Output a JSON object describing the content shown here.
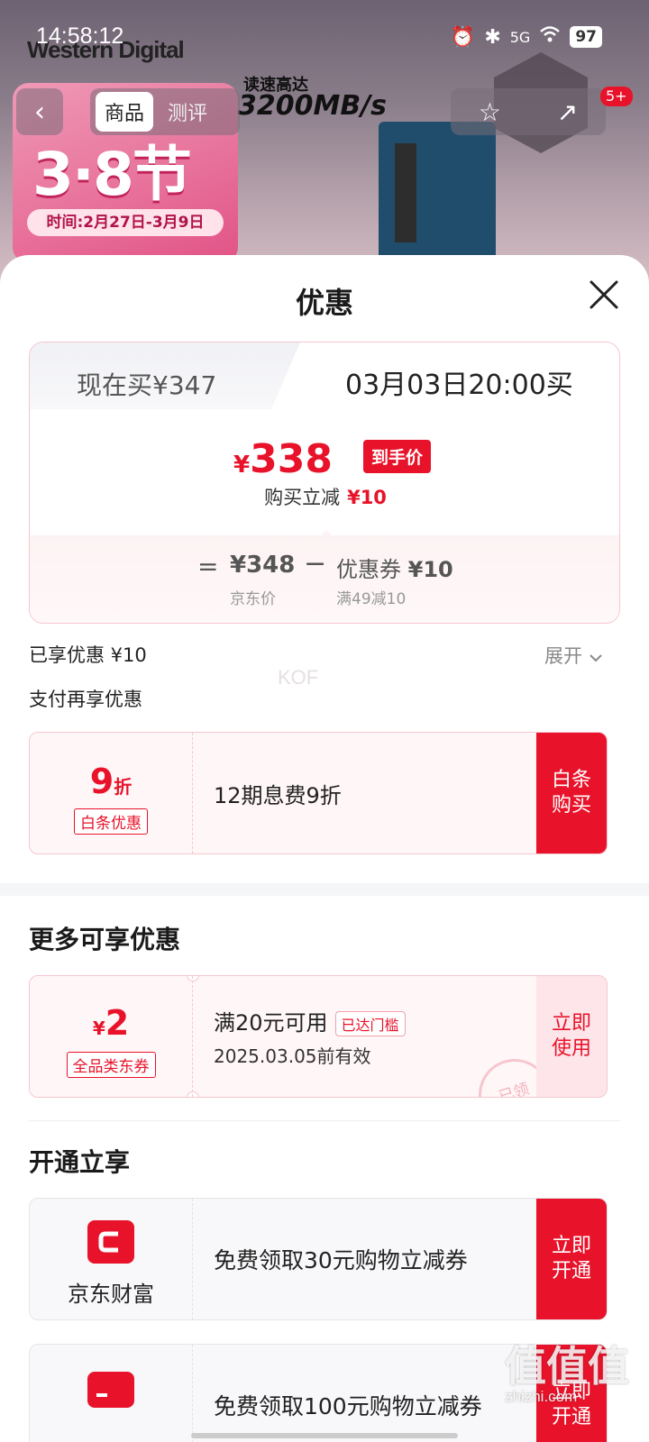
{
  "status_bar": {
    "time": "14:58:12",
    "battery": "97",
    "network": "5G"
  },
  "background": {
    "brand": "Western Digital",
    "speed_label": "读速高达",
    "speed_value": "3200MB/s",
    "festival": "3·8节",
    "festival_dates": "时间:2月27日-3月9日",
    "tabs": [
      "商品",
      "测评"
    ],
    "cart_badge": "5+"
  },
  "sheet": {
    "title": "优惠",
    "price_tabs": {
      "now": "现在买¥347",
      "later": "03月03日20:00买"
    },
    "final_price": {
      "symbol": "¥",
      "value": "338",
      "tag": "到手价"
    },
    "instant_reduce": {
      "label": "购买立减",
      "amount": "¥10"
    },
    "formula": {
      "eq": "=",
      "jd_price": "¥348",
      "jd_label": "京东价",
      "minus": "−",
      "coupon": "优惠券",
      "coupon_amount": "¥10",
      "coupon_rule": "满49减10"
    },
    "enjoyed": "已享优惠 ¥10",
    "expand": "展开",
    "watermark": "KOF",
    "pay_hint": "支付再享优惠",
    "baitiao": {
      "discount_num": "9",
      "discount_unit": "折",
      "tag": "白条优惠",
      "desc": "12期息费9折",
      "action": "白条购买"
    },
    "more_title": "更多可享优惠",
    "coupon": {
      "symbol": "¥",
      "amount": "2",
      "tag": "全品类东券",
      "title": "满20元可用",
      "threshold_tag": "已达门槛",
      "expire": "2025.03.05前有效",
      "action": "立即使用",
      "stamp": "已领"
    },
    "open_title": "开通立享",
    "open_items": [
      {
        "name": "京东财富",
        "desc": "免费领取30元购物立减券",
        "action": "立即开通"
      },
      {
        "name": "",
        "desc": "免费领取100元购物立减券",
        "action": "立即开通"
      }
    ]
  },
  "corner_watermark": {
    "logo": "值值值",
    "url": "zhizhi.com"
  },
  "colors": {
    "accent": "#e8132a",
    "coupon_bg": "#fff6f7",
    "border_pink": "#f6c7cf"
  }
}
